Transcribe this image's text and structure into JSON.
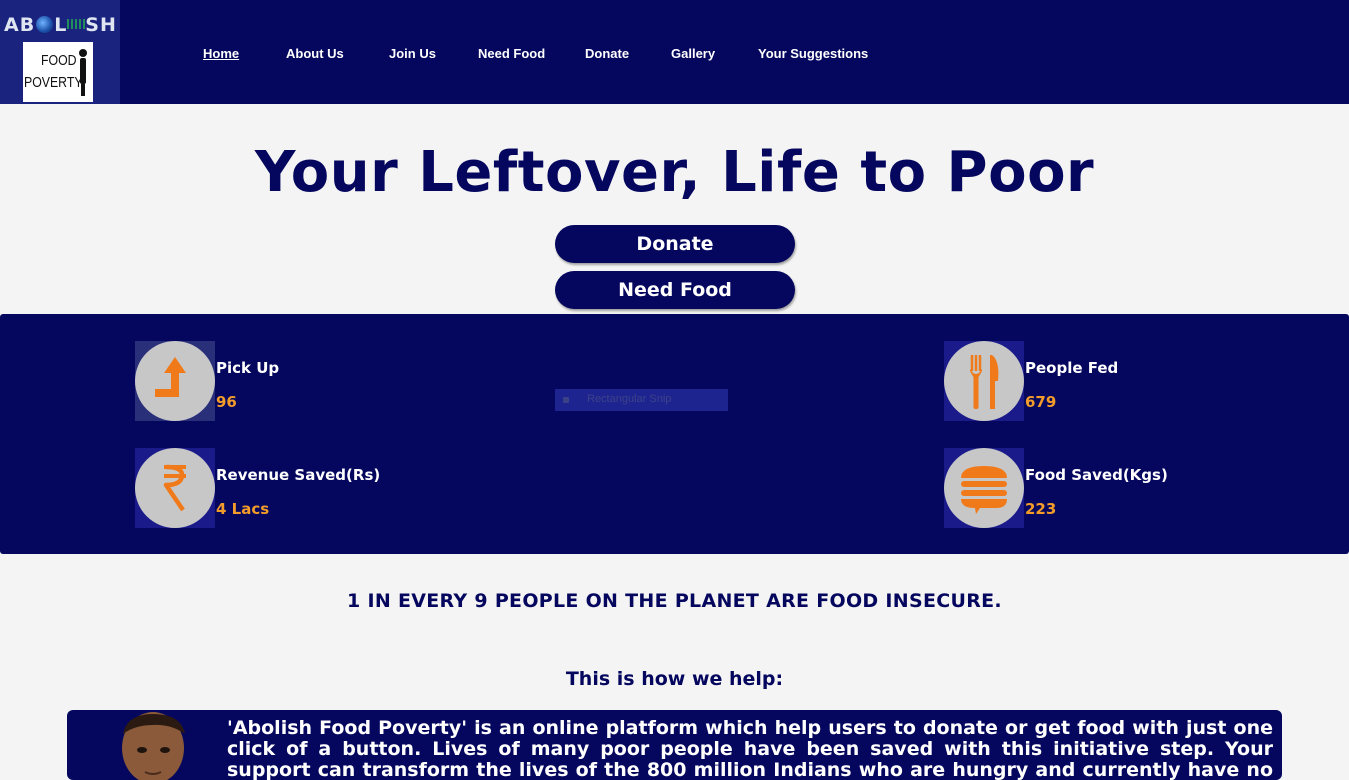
{
  "brand": {
    "top_text_left": "AB",
    "top_text_mid": "L",
    "top_text_right": "SH",
    "box_line1": "FOOD",
    "box_line2": "POVERTY"
  },
  "nav": {
    "items": [
      {
        "label": "Home",
        "active": true
      },
      {
        "label": "About Us"
      },
      {
        "label": "Join Us"
      },
      {
        "label": "Need Food"
      },
      {
        "label": "Donate"
      },
      {
        "label": "Gallery"
      },
      {
        "label": "Your Suggestions"
      }
    ]
  },
  "hero": {
    "title": "Your Leftover, Life to Poor",
    "donate_label": "Donate",
    "need_food_label": "Need Food"
  },
  "stats": {
    "pickup": {
      "label": "Pick Up",
      "value": "96",
      "icon": "arrow-up-icon"
    },
    "people_fed": {
      "label": "People Fed",
      "value": "679",
      "icon": "fork-knife-icon"
    },
    "revenue": {
      "label": "Revenue Saved(Rs)",
      "value": "4 Lacs",
      "icon": "rupee-icon"
    },
    "food_saved": {
      "label": "Food Saved(Kgs)",
      "value": "223",
      "icon": "food-icon"
    },
    "snip_label": "Rectangular Snip"
  },
  "fact": "1 IN EVERY 9 PEOPLE ON THE PLANET ARE FOOD INSECURE.",
  "help_heading": "This is how we help:",
  "about_text": "'Abolish Food Poverty' is an online platform which help users to donate or get food with just one click of a button. Lives of many poor people have been saved with this initiative step. Your support can transform the lives of the 800 million Indians who are hungry and currently have no assurance of food. In the robotic",
  "colors": {
    "navy": "#05075e",
    "accent": "#f39c2a",
    "icon_orange": "#f07a1a",
    "background": "#f4f4f4"
  }
}
